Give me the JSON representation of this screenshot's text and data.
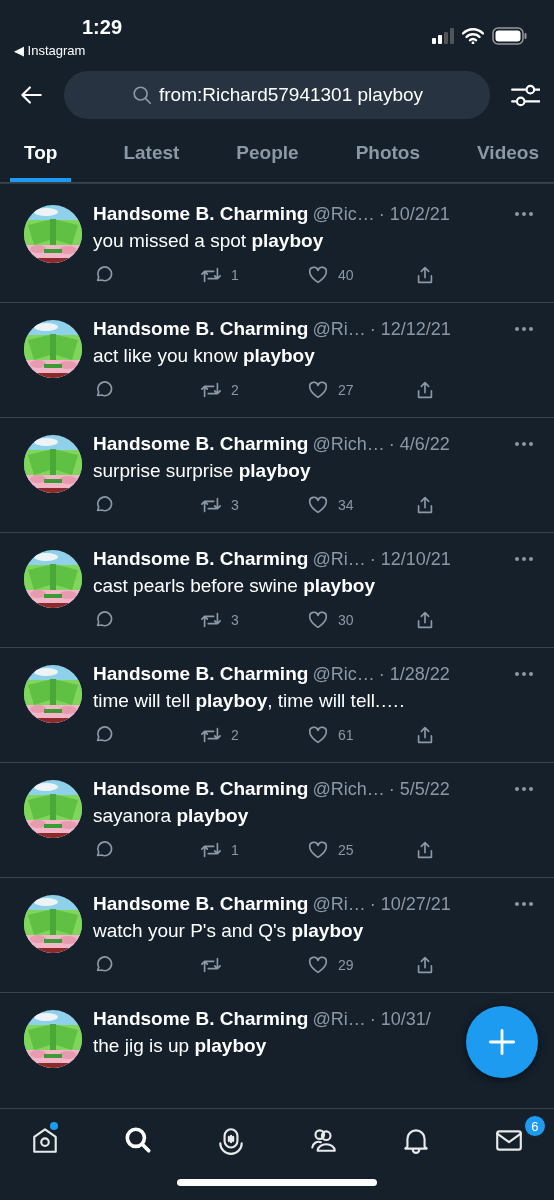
{
  "status_bar": {
    "time": "1:29",
    "back_app": "◀ Instagram"
  },
  "search": {
    "value": "from:Richard57941301 playboy"
  },
  "tabs": [
    {
      "label": "Top",
      "selected": true
    },
    {
      "label": "Latest",
      "selected": false
    },
    {
      "label": "People",
      "selected": false
    },
    {
      "label": "Photos",
      "selected": false
    },
    {
      "label": "Videos",
      "selected": false
    }
  ],
  "tweets": [
    {
      "name": "Handsome B. Charming",
      "handle": "@Ric…",
      "date": "· 10/2/21",
      "text": "you missed a spot **playboy**",
      "retweets": "1",
      "likes": "40"
    },
    {
      "name": "Handsome B. Charming",
      "handle": "@Ri…",
      "date": "· 12/12/21",
      "text": "act like you know **playboy**",
      "retweets": "2",
      "likes": "27"
    },
    {
      "name": "Handsome B. Charming",
      "handle": "@Rich…",
      "date": "· 4/6/22",
      "text": "surprise surprise **playboy**",
      "retweets": "3",
      "likes": "34"
    },
    {
      "name": "Handsome B. Charming",
      "handle": "@Ri…",
      "date": "· 12/10/21",
      "text": "cast pearls before swine **playboy**",
      "retweets": "3",
      "likes": "30"
    },
    {
      "name": "Handsome B. Charming",
      "handle": "@Ric…",
      "date": "· 1/28/22",
      "text": "time will tell **playboy**, time will tell.….",
      "retweets": "2",
      "likes": "61"
    },
    {
      "name": "Handsome B. Charming",
      "handle": "@Rich…",
      "date": "· 5/5/22",
      "text": "sayanora **playboy**",
      "retweets": "1",
      "likes": "25"
    },
    {
      "name": "Handsome B. Charming",
      "handle": "@Ri…",
      "date": "· 10/27/21",
      "text": "watch your P's and Q's **playboy**",
      "likes": "29"
    },
    {
      "name": "Handsome B. Charming",
      "handle": "@Ri…",
      "date": "· 10/31/",
      "text": "the jig is up **playboy**",
      "cut": true
    }
  ],
  "nav": [
    {
      "kind": "home",
      "selected": false,
      "dot": true
    },
    {
      "kind": "search",
      "selected": true
    },
    {
      "kind": "spaces",
      "selected": false
    },
    {
      "kind": "communities",
      "selected": false
    },
    {
      "kind": "notifications",
      "selected": false
    },
    {
      "kind": "messages",
      "selected": false,
      "badge": "6"
    }
  ]
}
